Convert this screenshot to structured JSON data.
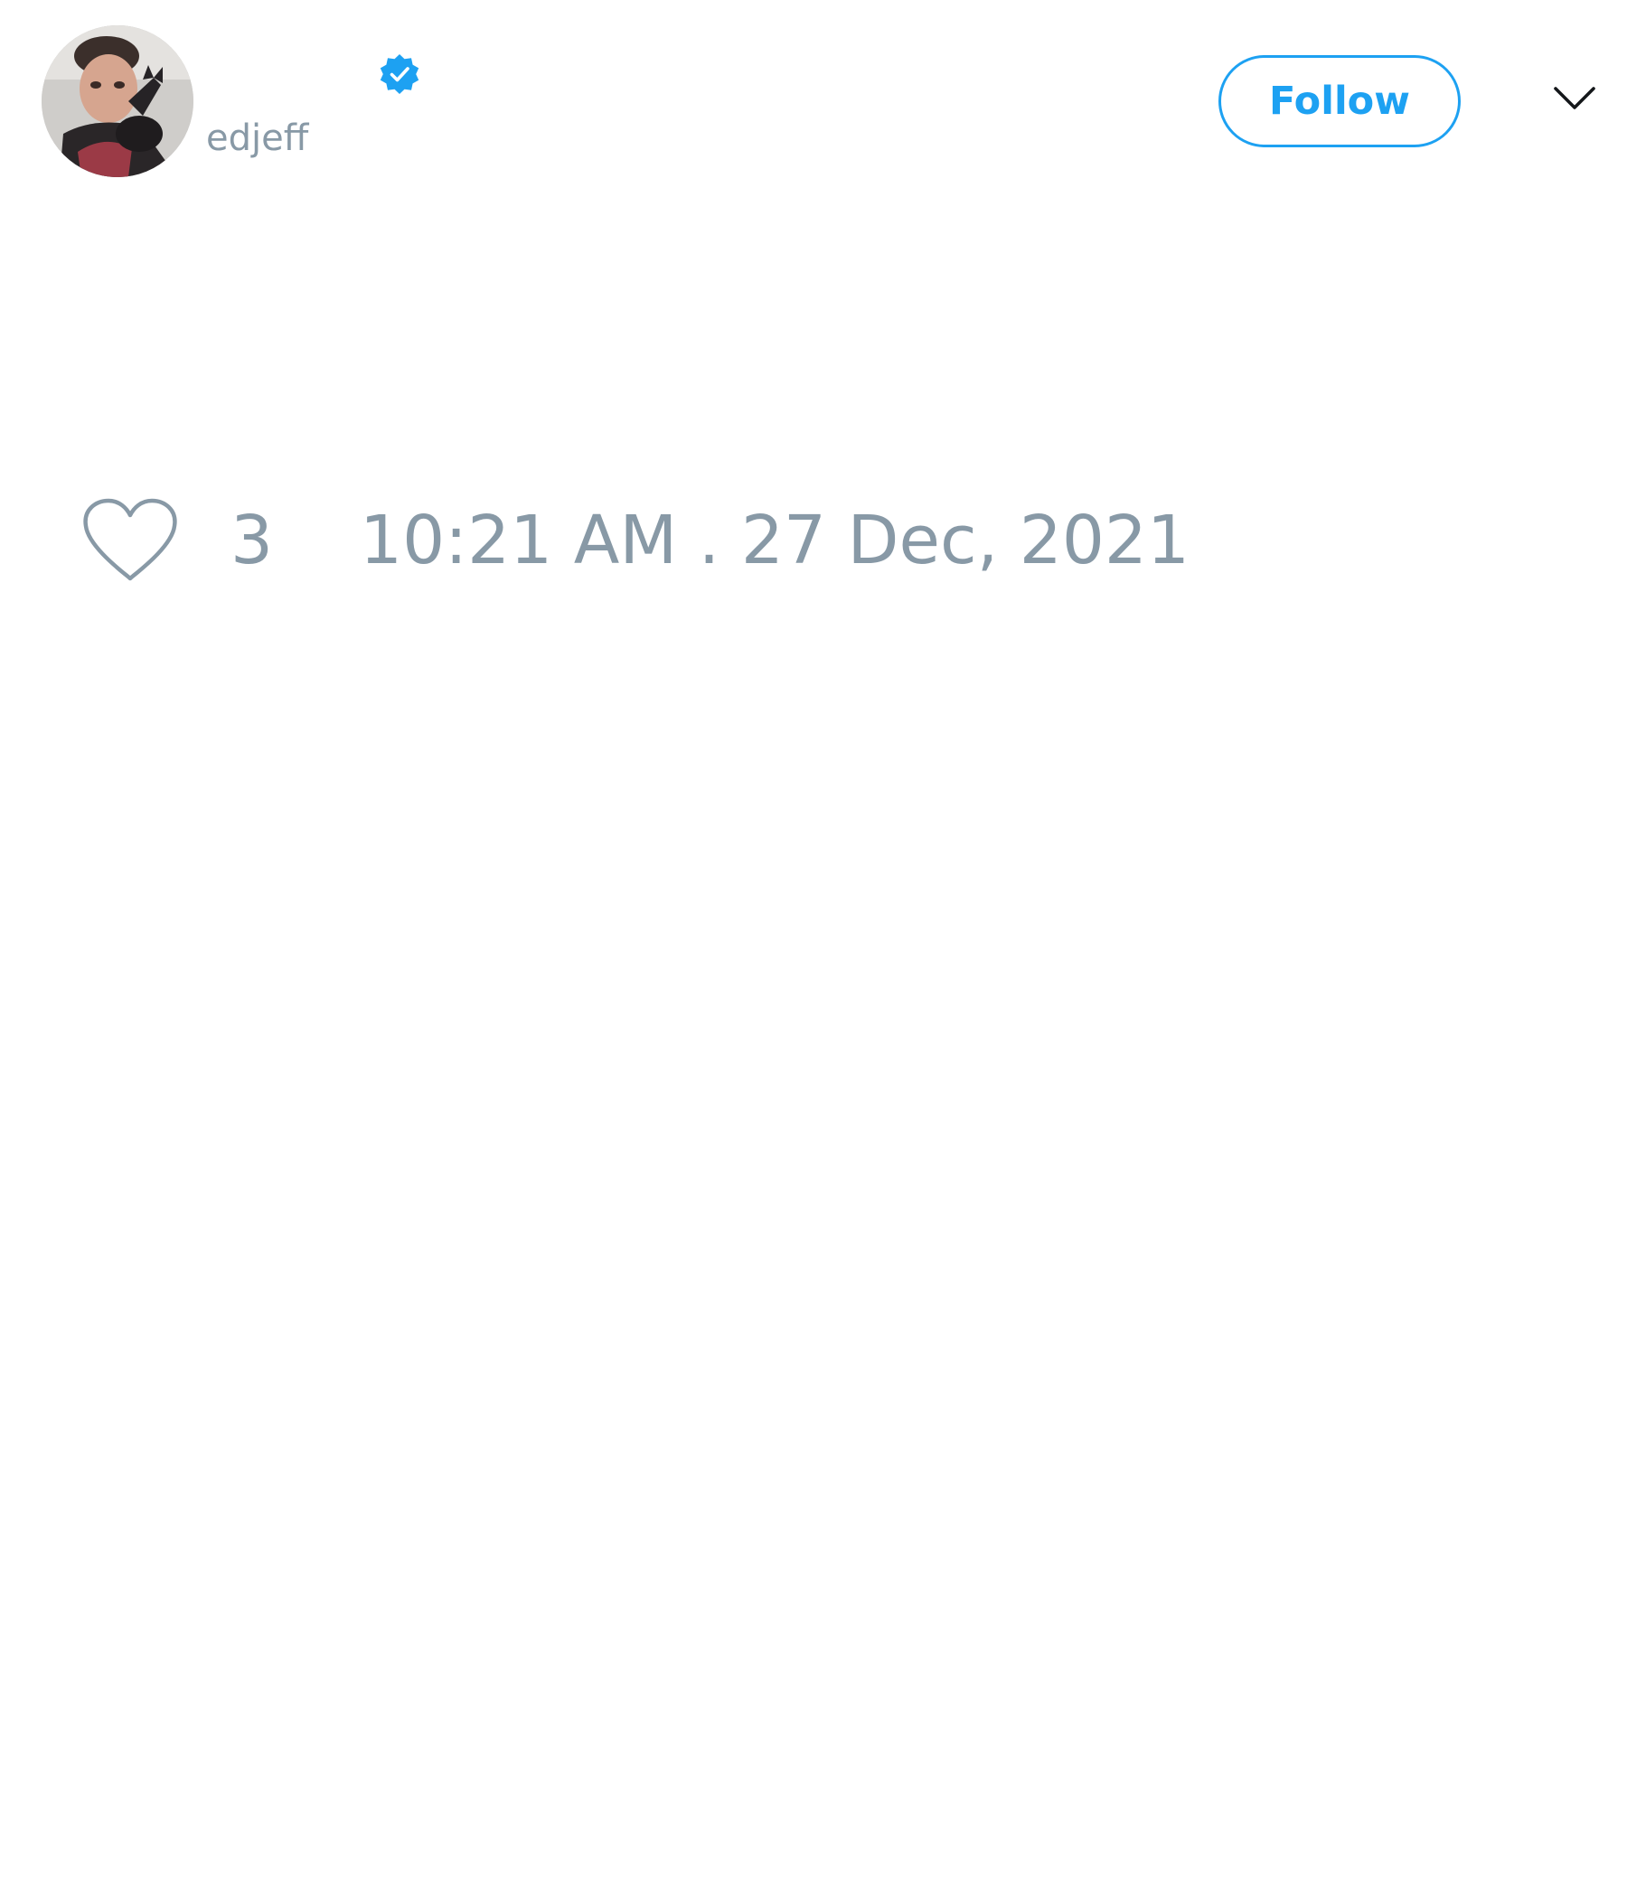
{
  "tweet": {
    "author": {
      "display_name": "",
      "handle": "edjeff",
      "verified": true,
      "avatar": "profile-photo"
    },
    "follow_label": "Follow",
    "menu_icon": "chevron-down-icon",
    "likes": {
      "icon": "heart-icon",
      "count": "3"
    },
    "timestamp": "10:21 AM . 27 Dec, 2021"
  },
  "colors": {
    "accent": "#1da1f2",
    "muted_text": "#8899a6",
    "background": "#ffffff"
  }
}
